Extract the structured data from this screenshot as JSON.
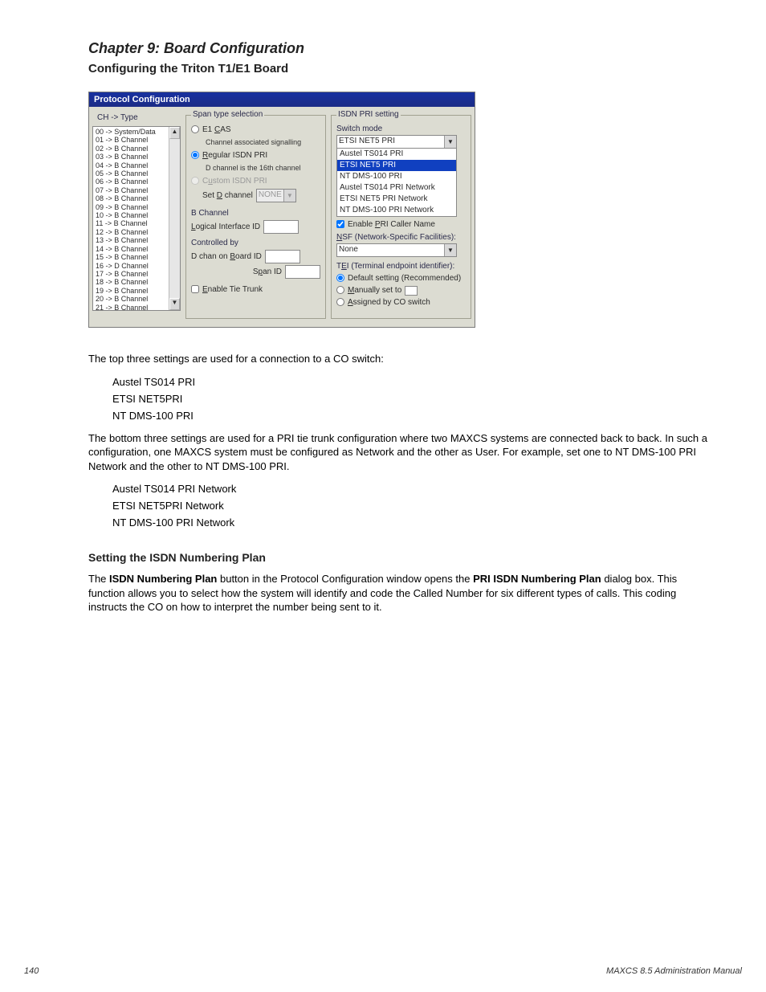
{
  "header": {
    "chapter_hint": "Chapter 9: Board Configuration",
    "section_title": "Configuring the Triton T1/E1 Board"
  },
  "window": {
    "title": "Protocol Configuration",
    "left_col_header": "CH   ->  Type",
    "channels": [
      "00 -> System/Data",
      "01 -> B Channel",
      "02 -> B Channel",
      "03 -> B Channel",
      "04 -> B Channel",
      "05 -> B Channel",
      "06 -> B Channel",
      "07 -> B Channel",
      "08 -> B Channel",
      "09 -> B Channel",
      "10 -> B Channel",
      "11 -> B Channel",
      "12 -> B Channel",
      "13 -> B Channel",
      "14 -> B Channel",
      "15 -> B Channel",
      "16 -> D Channel",
      "17 -> B Channel",
      "18 -> B Channel",
      "19 -> B Channel",
      "20 -> B Channel",
      "21 -> B Channel"
    ],
    "span_group": {
      "legend": "Span type selection",
      "e1cas_label": "E1 CAS",
      "e1cas_sub": "Channel associated signalling",
      "regular_label": "Regular ISDN PRI",
      "regular_sub": "D channel is the 16th channel",
      "custom_label": "Custom ISDN PRI",
      "setd_label": "Set D channel",
      "setd_value": "NONE",
      "bch_label": "B Channel",
      "logical_label": "Logical Interface ID",
      "controlled_label": "Controlled by",
      "dboard_label": "D chan on Board ID",
      "span_id_label": "Span ID",
      "enable_tie_label": "Enable Tie Trunk"
    },
    "isdn_group": {
      "legend": "ISDN PRI setting",
      "switch_mode_label": "Switch mode",
      "switch_mode_value": "ETSI NET5 PRI",
      "dropdown_items": [
        "Austel TS014 PRI",
        "ETSI NET5 PRI",
        "NT DMS-100 PRI",
        "",
        "Austel TS014 PRI Network",
        "ETSI NET5 PRI Network",
        "NT DMS-100 PRI Network"
      ],
      "enable_caller_label": "Enable PRI Caller Name",
      "nsf_label": "NSF (Network-Specific Facilities):",
      "nsf_value": "None",
      "tei_label": "TEI (Terminal endpoint identifier):",
      "tei_default": "Default setting (Recommended)",
      "tei_manual": "Manually set to",
      "tei_assigned": "Assigned by CO switch"
    }
  },
  "doc": {
    "p1": "The top three settings are used for a connection to a CO switch:",
    "list1": [
      "Austel TS014 PRI",
      "ETSI NET5PRI",
      "NT DMS-100 PRI"
    ],
    "p2": "The bottom three settings are used for a PRI tie trunk configuration where two MAXCS systems are connected back to back. In such a configuration, one MAXCS system must be configured as Network and the other as User. For example, set one to NT DMS-100 PRI Network and the other to NT DMS-100 PRI.",
    "list2": [
      "Austel TS014 PRI Network",
      "ETSI NET5PRI Network",
      "NT DMS-100 PRI Network"
    ],
    "subheading": "Setting the ISDN Numbering Plan",
    "p3a": "The ",
    "p3b": "ISDN Numbering Plan",
    "p3c": " button in the Protocol Configuration window opens the ",
    "p3d": "PRI ISDN Numbering Plan",
    "p3e": " dialog box. This function allows you to select how the system will identify and code the Called Number for six different types of calls. This coding instructs the CO on how to interpret the number being sent to it."
  },
  "footer": {
    "left": "140",
    "right": "MAXCS 8.5 Administration Manual"
  }
}
